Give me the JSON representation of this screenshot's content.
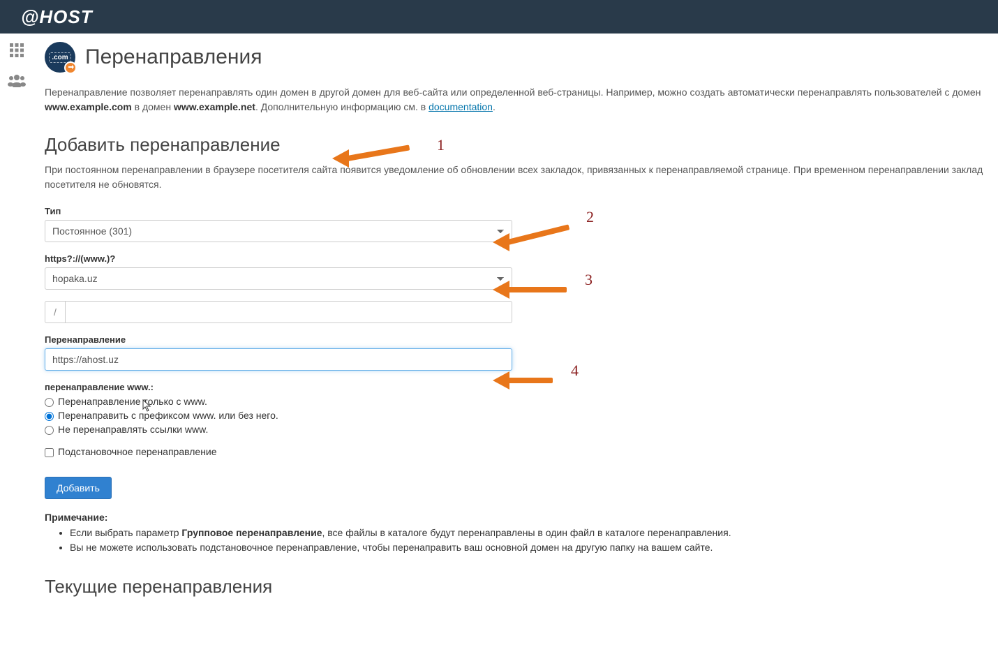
{
  "header": {
    "logo": "@HOST"
  },
  "page": {
    "title": "Перенаправления",
    "icon_text": ".com",
    "intro_part1": "Перенаправление позволяет перенаправлять один домен в другой домен для веб-сайта или определенной веб-страницы. Например, можно создать автоматически перенаправлять пользователей с домен ",
    "intro_domain1": "www.example.com",
    "intro_part2": " в домен ",
    "intro_domain2": "www.example.net",
    "intro_part3": ". Дополнительную информацию см. в ",
    "intro_link": "documentation",
    "intro_part4": "."
  },
  "addSection": {
    "heading": "Добавить перенаправление",
    "desc": "При постоянном перенаправлении в браузере посетителя сайта появится уведомление об обновлении всех закладок, привязанных к перенаправляемой странице. При временном перенаправлении заклад посетителя не обновятся."
  },
  "form": {
    "type_label": "Тип",
    "type_value": "Постоянное (301)",
    "domain_label": "https?://(www.)?",
    "domain_value": "hopaka.uz",
    "path_prefix": "/",
    "path_value": "",
    "redirect_label": "Перенаправление",
    "redirect_value": "https://ahost.uz",
    "www_group_label": "перенаправление www.:",
    "radio1": "Перенаправление только с www.",
    "radio2": "Перенаправить с префиксом www. или без него.",
    "radio3": "Не перенаправлять ссылки www.",
    "wildcard_label": "Подстановочное перенаправление",
    "submit": "Добавить"
  },
  "note": {
    "heading": "Примечание:",
    "item1_a": "Если выбрать параметр ",
    "item1_b": "Групповое перенаправление",
    "item1_c": ", все файлы в каталоге будут перенаправлены в один файл в каталоге перенаправления.",
    "item2": "Вы не можете использовать подстановочное перенаправление, чтобы перенаправить ваш основной домен на другую папку на вашем сайте."
  },
  "currentSection": {
    "heading": "Текущие перенаправления"
  },
  "annotations": {
    "n1": "1",
    "n2": "2",
    "n3": "3",
    "n4": "4"
  }
}
